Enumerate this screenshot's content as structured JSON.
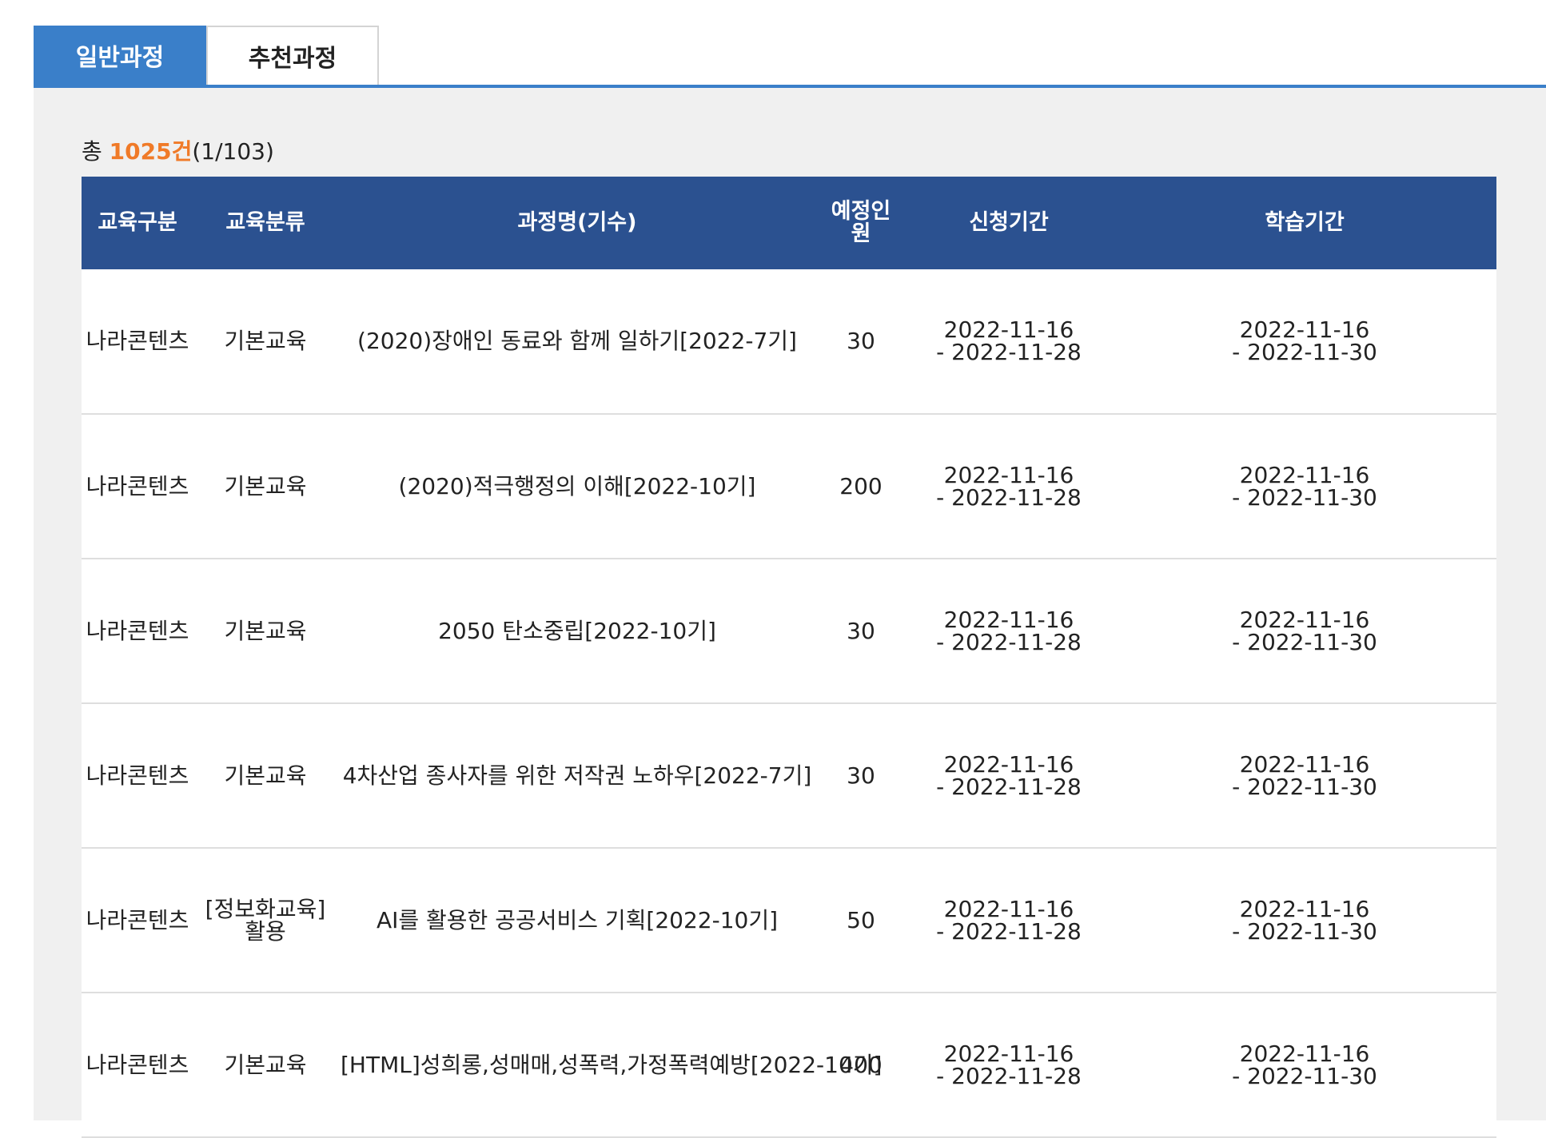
{
  "tabs": [
    {
      "label": "일반과정",
      "active": true
    },
    {
      "label": "추천과정",
      "active": false
    }
  ],
  "summary": {
    "prefix": "총",
    "count": "1025건",
    "pages": "(1/103)"
  },
  "table": {
    "headers": [
      "교육구분",
      "교육분류",
      "과정명(기수)",
      "예정인원",
      "신청기간",
      "학습기간"
    ],
    "rows": [
      {
        "category": "나라콘텐츠",
        "classification": "기본교육",
        "course": "(2020)장애인 동료와 함께 일하기[2022-7기]",
        "capacity": "30",
        "apply_period": "2022-11-16\n- 2022-11-28",
        "study_period": "2022-11-16\n- 2022-11-30"
      },
      {
        "category": "나라콘텐츠",
        "classification": "기본교육",
        "course": "(2020)적극행정의 이해[2022-10기]",
        "capacity": "200",
        "apply_period": "2022-11-16\n- 2022-11-28",
        "study_period": "2022-11-16\n- 2022-11-30"
      },
      {
        "category": "나라콘텐츠",
        "classification": "기본교육",
        "course": "2050 탄소중립[2022-10기]",
        "capacity": "30",
        "apply_period": "2022-11-16\n- 2022-11-28",
        "study_period": "2022-11-16\n- 2022-11-30"
      },
      {
        "category": "나라콘텐츠",
        "classification": "기본교육",
        "course": "4차산업 종사자를 위한 저작권 노하우[2022-7기]",
        "capacity": "30",
        "apply_period": "2022-11-16\n- 2022-11-28",
        "study_period": "2022-11-16\n- 2022-11-30"
      },
      {
        "category": "나라콘텐츠",
        "classification": "[정보화교육]\n활용",
        "course": "AI를 활용한 공공서비스 기획[2022-10기]",
        "capacity": "50",
        "apply_period": "2022-11-16\n- 2022-11-28",
        "study_period": "2022-11-16\n- 2022-11-30"
      },
      {
        "category": "나라콘텐츠",
        "classification": "기본교육",
        "course": "[HTML]성희롱,성매매,성폭력,가정폭력예방[2022-10기]",
        "capacity": "400",
        "apply_period": "2022-11-16\n- 2022-11-28",
        "study_period": "2022-11-16\n- 2022-11-30"
      }
    ]
  }
}
